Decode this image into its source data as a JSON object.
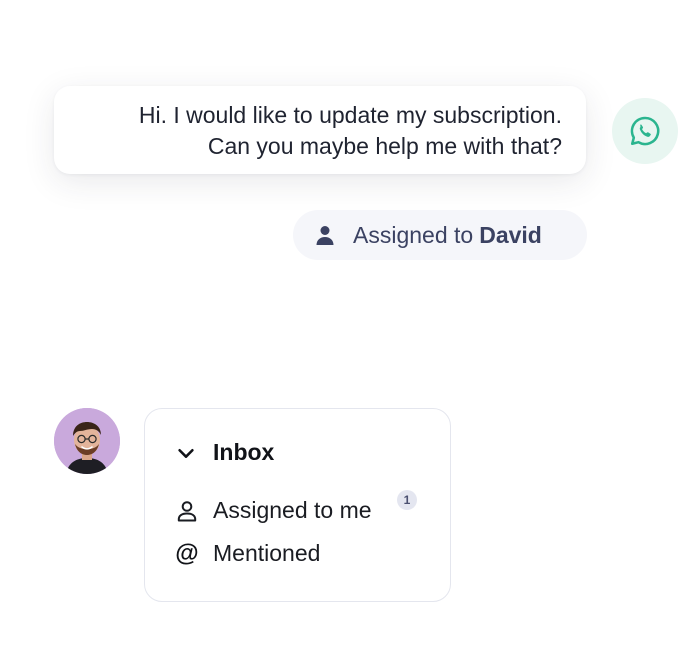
{
  "message": {
    "lines": [
      "Hi. I would like to update my subscription.",
      "Can you maybe help me with that?"
    ],
    "channel_icon": "whatsapp-icon",
    "channel_color": "#2bb58f"
  },
  "assignment": {
    "prefix": "Assigned to",
    "assignee": "David",
    "icon": "person-icon",
    "text_color": "#3b4262"
  },
  "agent": {
    "avatar_icon": "avatar",
    "avatar_bg": "#c9a9dc"
  },
  "inbox": {
    "title": "Inbox",
    "expand_icon": "chevron-down-icon",
    "items": [
      {
        "label": "Assigned to me",
        "icon": "user-outline-icon",
        "count": "1"
      },
      {
        "label": "Mentioned",
        "icon": "at-sign-icon"
      }
    ]
  }
}
